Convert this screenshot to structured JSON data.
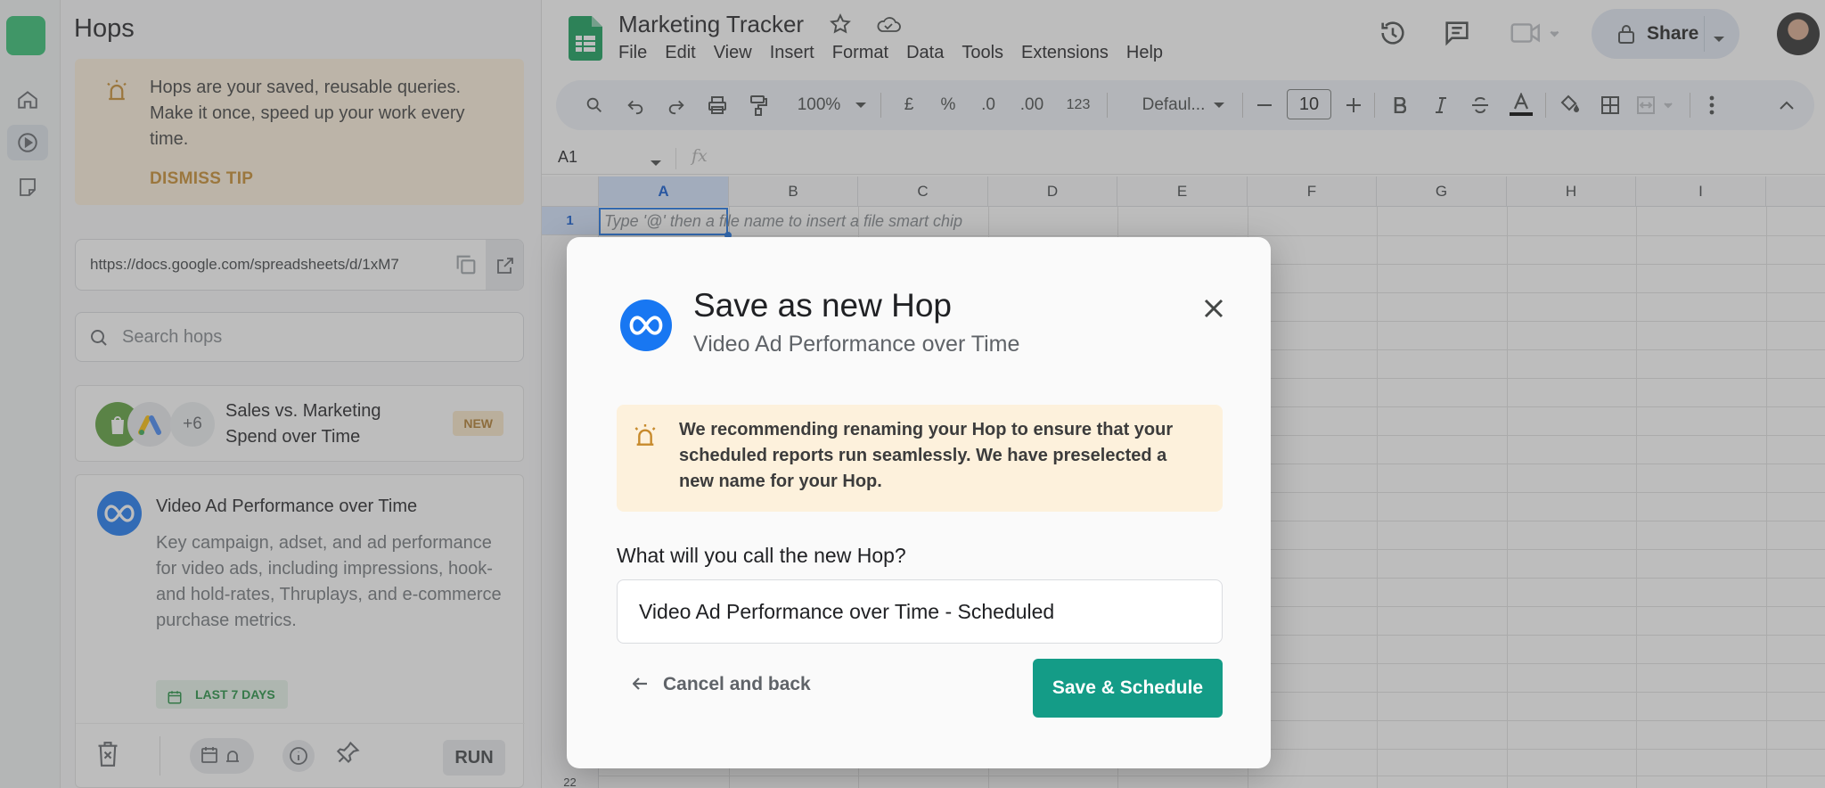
{
  "hops_panel": {
    "title": "Hops",
    "tip": {
      "text": "Hops are your saved, reusable queries. Make it once, speed up your work every time.",
      "dismiss_label": "DISMISS TIP"
    },
    "url": "https://docs.google.com/spreadsheets/d/1xM7",
    "search_placeholder": "Search hops",
    "cards": [
      {
        "name": "Sales vs. Marketing Spend over Time",
        "extra_count": "+6",
        "badge": "NEW"
      },
      {
        "name": "Video Ad Performance over Time",
        "description": "Key campaign, adset, and ad performance for video ads, including impressions, hook- and hold-rates, Thruplays, and e-commerce purchase metrics.",
        "date_range": "LAST 7 DAYS",
        "run_label": "RUN"
      }
    ]
  },
  "sheets": {
    "doc_title": "Marketing Tracker",
    "menu": [
      "File",
      "Edit",
      "View",
      "Insert",
      "Format",
      "Data",
      "Tools",
      "Extensions",
      "Help"
    ],
    "share_label": "Share",
    "toolbar": {
      "zoom": "100%",
      "currency": "£",
      "percent": "%",
      "dec_decrease": ".0",
      "dec_increase": ".00",
      "number_format": "123",
      "font": "Defaul...",
      "font_size": "10"
    },
    "name_box": "A1",
    "fx_label": "fx",
    "columns": [
      "A",
      "B",
      "C",
      "D",
      "E",
      "F",
      "G",
      "H",
      "I"
    ],
    "rows": [
      "1"
    ],
    "row_partial": "22",
    "cell_hint": "Type '@' then a file name to insert a file smart chip"
  },
  "modal": {
    "title": "Save as new Hop",
    "subtitle": "Video Ad Performance over Time",
    "notice": "We recommending renaming your Hop to ensure that your scheduled reports run seamlessly. We have preselected a new name for your Hop.",
    "question": "What will you call the new Hop?",
    "input_value": "Video Ad Performance over Time - Scheduled",
    "cancel_label": "Cancel and back",
    "save_label": "Save & Schedule"
  },
  "colors": {
    "accent_teal": "#149c87",
    "meta_blue": "#1877f2",
    "tip_bg": "#fdf1dc",
    "selection_blue": "#1a73e8"
  }
}
